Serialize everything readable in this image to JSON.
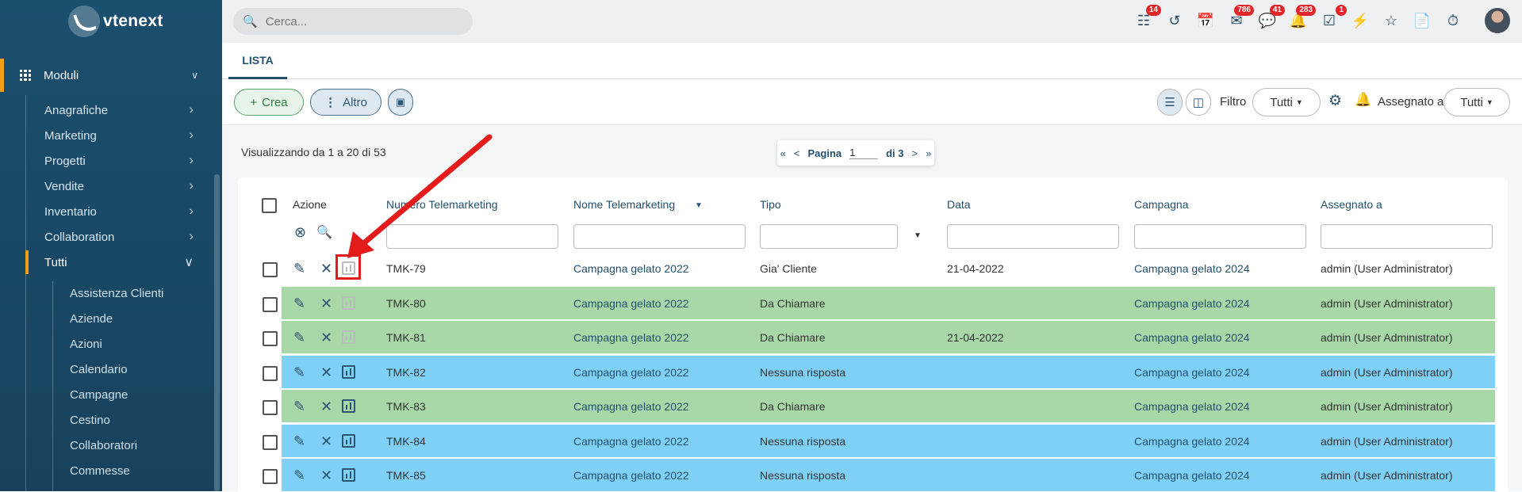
{
  "brand": "vtenext",
  "sidebar": {
    "section": "Moduli",
    "items": [
      {
        "label": "Anagrafiche"
      },
      {
        "label": "Marketing"
      },
      {
        "label": "Progetti"
      },
      {
        "label": "Vendite"
      },
      {
        "label": "Inventario"
      },
      {
        "label": "Collaboration"
      },
      {
        "label": "Tutti"
      }
    ],
    "subitems": [
      "Assistenza Clienti",
      "Aziende",
      "Azioni",
      "Calendario",
      "Campagne",
      "Cestino",
      "Collaboratori",
      "Commesse"
    ]
  },
  "topbar": {
    "search_placeholder": "Cerca...",
    "icons": [
      {
        "name": "hierarchy-icon",
        "badge": "14"
      },
      {
        "name": "history-icon",
        "badge": ""
      },
      {
        "name": "calendar-icon",
        "badge": ""
      },
      {
        "name": "mail-icon",
        "badge": "786"
      },
      {
        "name": "chat-icon",
        "badge": "41"
      },
      {
        "name": "bell-icon",
        "badge": "283"
      },
      {
        "name": "tasks-icon",
        "badge": "1"
      },
      {
        "name": "lightning-icon",
        "badge": ""
      },
      {
        "name": "star-icon",
        "badge": ""
      },
      {
        "name": "document-icon",
        "badge": ""
      },
      {
        "name": "timer-icon",
        "badge": ""
      }
    ]
  },
  "tab": "LISTA",
  "toolbar": {
    "crea": "Crea",
    "altro": "Altro",
    "filtro_label": "Filtro",
    "filtro_value": "Tutti",
    "assegnato_label": "Assegnato a",
    "assegnato_value": "Tutti"
  },
  "listing": {
    "showing": "Visualizzando da 1 a 20 di 53",
    "pager": {
      "first": "«",
      "prev": "<",
      "label": "Pagina",
      "page": "1",
      "of": "di 3",
      "next": ">",
      "last": "»"
    }
  },
  "table": {
    "headers": [
      "Azione",
      "Numero Telemarketing",
      "Nome Telemarketing",
      "Tipo",
      "Data",
      "Campagna",
      "Assegnato a"
    ],
    "rows": [
      {
        "numero": "TMK-79",
        "nome": "Campagna gelato 2022",
        "tipo": "Gia' Cliente",
        "data": "21-04-2022",
        "campagna": "Campagna gelato 2024",
        "assegnato": "admin (User Administrator)",
        "color": "#ffffff",
        "stat_enabled": false
      },
      {
        "numero": "TMK-80",
        "nome": "Campagna gelato 2022",
        "tipo": "Da Chiamare",
        "data": "",
        "campagna": "Campagna gelato 2024",
        "assegnato": "admin (User Administrator)",
        "color": "#a8d8a8",
        "stat_enabled": false
      },
      {
        "numero": "TMK-81",
        "nome": "Campagna gelato 2022",
        "tipo": "Da Chiamare",
        "data": "21-04-2022",
        "campagna": "Campagna gelato 2024",
        "assegnato": "admin (User Administrator)",
        "color": "#a8d8a8",
        "stat_enabled": false
      },
      {
        "numero": "TMK-82",
        "nome": "Campagna gelato 2022",
        "tipo": "Nessuna risposta",
        "data": "",
        "campagna": "Campagna gelato 2024",
        "assegnato": "admin (User Administrator)",
        "color": "#7fd0f6",
        "stat_enabled": true
      },
      {
        "numero": "TMK-83",
        "nome": "Campagna gelato 2022",
        "tipo": "Da Chiamare",
        "data": "",
        "campagna": "Campagna gelato 2024",
        "assegnato": "admin (User Administrator)",
        "color": "#a8d8a8",
        "stat_enabled": true
      },
      {
        "numero": "TMK-84",
        "nome": "Campagna gelato 2022",
        "tipo": "Nessuna risposta",
        "data": "",
        "campagna": "Campagna gelato 2024",
        "assegnato": "admin (User Administrator)",
        "color": "#7fd0f6",
        "stat_enabled": true
      },
      {
        "numero": "TMK-85",
        "nome": "Campagna gelato 2022",
        "tipo": "Nessuna risposta",
        "data": "",
        "campagna": "Campagna gelato 2024",
        "assegnato": "admin (User Administrator)",
        "color": "#7fd0f6",
        "stat_enabled": true
      }
    ]
  }
}
